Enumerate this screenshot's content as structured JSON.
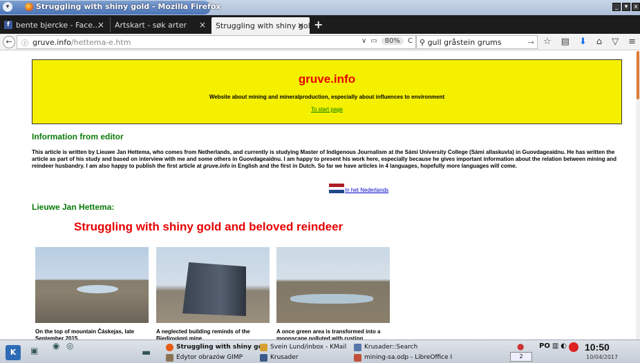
{
  "window": {
    "title": "Struggling with shiny gold - Mozilla Firefox",
    "menu_glyph": "▾",
    "buttons": [
      "_",
      "▾",
      "x"
    ]
  },
  "tabs": [
    {
      "label": "bente bjercke - Face...",
      "close": "×",
      "icon": "facebook-icon"
    },
    {
      "label": "Artskart - søk arter",
      "close": "×"
    },
    {
      "label": "Struggling with shiny gold",
      "close": "×",
      "active": true
    }
  ],
  "newtab_label": "+",
  "navbar": {
    "back_glyph": "←",
    "info_glyph": "ⓘ",
    "url_host": "gruve.info",
    "url_path": "/hettema-e.htm",
    "dropdown_glyph": "∨",
    "reader_glyph": "▭",
    "zoom": "80%",
    "reload_glyph": "C",
    "search_icon_glyph": "⚲",
    "search_value": "gull gråstein grums",
    "search_go_glyph": "→",
    "icons": [
      "☆",
      "▤",
      "⬇",
      "⌂",
      "▽",
      "≡"
    ]
  },
  "page": {
    "banner_title": "gruve.info",
    "banner_subtitle": "Website about mining and mineralproduction, especially about influences to environment",
    "start_link": "To start page",
    "editor_heading": "Information from editor",
    "intro_before_em": "This article is written by Lieuwe Jan Hettema, who comes from Netherlands, and currently is studying Master of Indigenous Journalism at the Sámi University College (Sámi allaskuvla) in Guovdageaidnu. He has written the article as part of his study and based on interview with me and some others in Guovdageaidnu. I am happy to present his work here, especially because he gives important information about the relation between mining and reindeer husbandry. I am also happy to publish the first article at ",
    "intro_em": "gruve.info",
    "intro_after_em": " in English and the first in Dutch. So far we have articles in 4 languages, hopefully more languages will come.",
    "dutch_link": "In het Nederlands",
    "flag_colors": [
      "#ae1c28",
      "#ffffff",
      "#21468b"
    ],
    "author_heading": "Lieuwe Jan Hettema:",
    "article_title": "Struggling with shiny gold and beloved reindeer",
    "photos": [
      {
        "caption": "On the top of mountain Čáskejas, late September 2015."
      },
      {
        "caption": "A neglected building reminds of the Biedjovággi mine."
      },
      {
        "caption": "A once green area is transformed into a moonscape polluted with rusting"
      }
    ]
  },
  "taskbar": {
    "kmenu_label": "K",
    "tasks": [
      {
        "label": "Struggling with shiny gol",
        "bold": true
      },
      {
        "label": "Svein Lund/inbox - KMail"
      },
      {
        "label": "Krusader::Search"
      },
      {
        "label": "Edytor obrazów GIMP"
      },
      {
        "label": "Krusader"
      },
      {
        "label": "mining-sa.odp - LibreOffice I"
      }
    ],
    "pager": "2",
    "tray_label": "PO",
    "clock": "10:50",
    "date": "10/04/2017"
  },
  "colors": {
    "banner_bg": "#f5f000",
    "heading_green": "#0a7a0a",
    "title_red": "#e60000",
    "link_blue": "#0000cc"
  }
}
